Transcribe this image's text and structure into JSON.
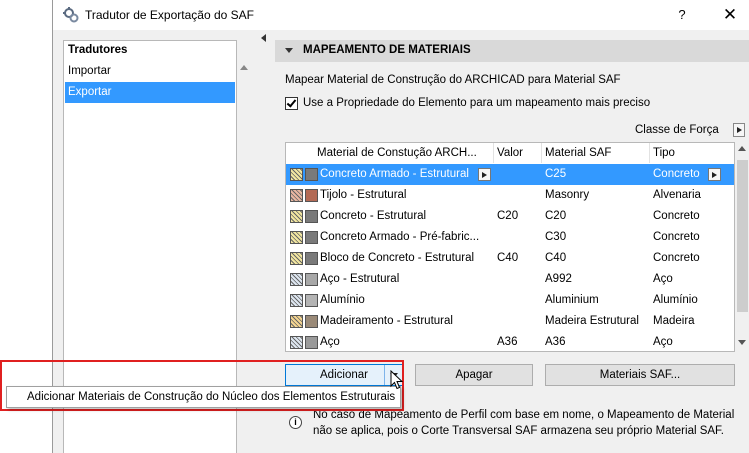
{
  "window": {
    "title": "Tradutor de Exportação do SAF",
    "help_label": "?",
    "close_label": "✕"
  },
  "left_panel": {
    "header": "Tradutores",
    "items": [
      {
        "label": "Importar",
        "selected": false
      },
      {
        "label": "Exportar",
        "selected": true
      }
    ]
  },
  "section": {
    "title": "MAPEAMENTO DE MATERIAIS",
    "description": "Mapear Material de Construção do ARCHICAD para Material SAF",
    "checkbox_label": "Use a Propriedade do Elemento para um mapeamento mais preciso",
    "checkbox_checked": true,
    "force_class_label": "Classe de Força"
  },
  "table": {
    "columns": [
      "Material de Constução ARCH...",
      "Valor",
      "Material SAF",
      "Tipo"
    ],
    "rows": [
      {
        "name": "Concreto Armado - Estrutural",
        "value": "",
        "saf": "C25",
        "type": "Concreto",
        "pattern": "#f2e6a0",
        "color": "#7a7a7a",
        "selected": true
      },
      {
        "name": "Tijolo - Estrutural",
        "value": "",
        "saf": "Masonry",
        "type": "Alvenaria",
        "pattern": "#e8b6a0",
        "color": "#b36a55",
        "selected": false
      },
      {
        "name": "Concreto - Estrutural",
        "value": "C20",
        "saf": "C20",
        "type": "Concreto",
        "pattern": "#f2e6a0",
        "color": "#7a7a7a",
        "selected": false
      },
      {
        "name": "Concreto Armado - Pré-fabric...",
        "value": "",
        "saf": "C30",
        "type": "Concreto",
        "pattern": "#f2e6a0",
        "color": "#7a7a7a",
        "selected": false
      },
      {
        "name": "Bloco de Concreto - Estrutural",
        "value": "C40",
        "saf": "C40",
        "type": "Concreto",
        "pattern": "#f2e6a0",
        "color": "#7a7a7a",
        "selected": false
      },
      {
        "name": "Aço - Estrutural",
        "value": "",
        "saf": "A992",
        "type": "Aço",
        "pattern": "#dde6f0",
        "color": "#a8a8a8",
        "selected": false
      },
      {
        "name": "Alumínio",
        "value": "",
        "saf": "Aluminium",
        "type": "Alumínio",
        "pattern": "#dde6f0",
        "color": "#b4b4b4",
        "selected": false
      },
      {
        "name": "Madeiramento - Estrutural",
        "value": "",
        "saf": "Madeira Estrutural",
        "type": "Madeira",
        "pattern": "#f5d590",
        "color": "#9a8a78",
        "selected": false
      },
      {
        "name": "Aço",
        "value": "A36",
        "saf": "A36",
        "type": "Aço",
        "pattern": "#dde6f0",
        "color": "#9a9a9a",
        "selected": false
      }
    ]
  },
  "buttons": {
    "add": "Adicionar",
    "clear": "Apagar",
    "saf_materials": "Materiais SAF..."
  },
  "popup": {
    "item": "Adicionar Materiais de Construção do Núcleo dos Elementos Estruturais"
  },
  "info": {
    "line1": "No caso de Mapeamento de Perfil com base em nome, o Mapeamento de Material",
    "line2": "não se aplica, pois o Corte Transversal SAF armazena seu próprio Material SAF."
  },
  "colors": {
    "selection": "#3399ff",
    "highlight_frame": "#e02020"
  }
}
